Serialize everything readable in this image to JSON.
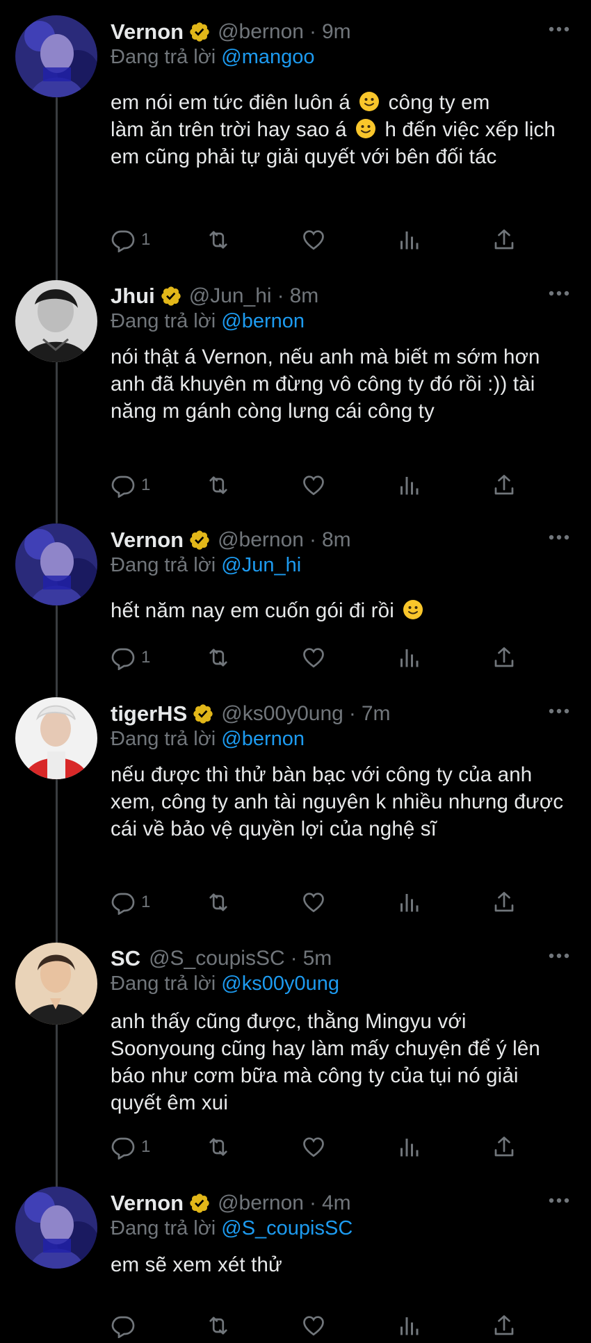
{
  "tweets": [
    {
      "name": "Vernon",
      "handle": "@bernon",
      "time": "9m",
      "reply_prefix": "Đang trả lời",
      "reply_mention": "@mangoo",
      "text_parts": [
        "em nói em tức điên luôn á",
        "công ty em",
        "làm ăn trên trời hay sao á",
        "h đến việc xếp lịch em cũng phải tự giải quyết với bên đối tác"
      ],
      "reply_count": "1"
    },
    {
      "name": "Jhui",
      "handle": "@Jun_hi",
      "time": "8m",
      "reply_prefix": "Đang trả lời",
      "reply_mention": "@bernon",
      "text": "nói thật á Vernon, nếu anh mà biết m sớm hơn anh đã khuyên m đừng vô công ty đó rồi :)) tài năng m gánh còng lưng cái công ty",
      "reply_count": "1"
    },
    {
      "name": "Vernon",
      "handle": "@bernon",
      "time": "8m",
      "reply_prefix": "Đang trả lời",
      "reply_mention": "@Jun_hi",
      "text": "hết năm nay em cuốn gói đi rồi",
      "reply_count": "1"
    },
    {
      "name": "tigerHS",
      "handle": "@ks00y0ung",
      "time": "7m",
      "reply_prefix": "Đang trả lời",
      "reply_mention": "@bernon",
      "text": "nếu được thì thử bàn bạc với công ty của anh xem, công ty anh tài nguyên k nhiều nhưng được cái về bảo vệ quyền lợi của nghệ sĩ",
      "reply_count": "1"
    },
    {
      "name": "SC",
      "handle": "@S_coupisSC",
      "time": "5m",
      "reply_prefix": "Đang trả lời",
      "reply_mention": "@ks00y0ung",
      "text": "anh thấy cũng được, thằng Mingyu với Soonyoung cũng hay làm mấy chuyện để ý lên báo như cơm bữa mà công ty của tụi nó giải quyết êm xui",
      "reply_count": "1"
    },
    {
      "name": "Vernon",
      "handle": "@bernon",
      "time": "4m",
      "reply_prefix": "Đang trả lời",
      "reply_mention": "@S_coupisSC",
      "text": "em sẽ xem xét thử",
      "reply_count": ""
    }
  ],
  "icons": {
    "verified": "verified-badge-icon",
    "more": "more-options-icon",
    "reply": "reply-icon",
    "retweet": "retweet-icon",
    "like": "heart-icon",
    "views": "views-chart-icon",
    "share": "share-icon",
    "emoji": "slightly-smiling-face-emoji"
  },
  "colors": {
    "background": "#000000",
    "text_primary": "#e7e9ea",
    "text_secondary": "#71767b",
    "link": "#1d9bf0",
    "verified_gold": "#e2b719",
    "thread_line": "#3a3d40"
  }
}
